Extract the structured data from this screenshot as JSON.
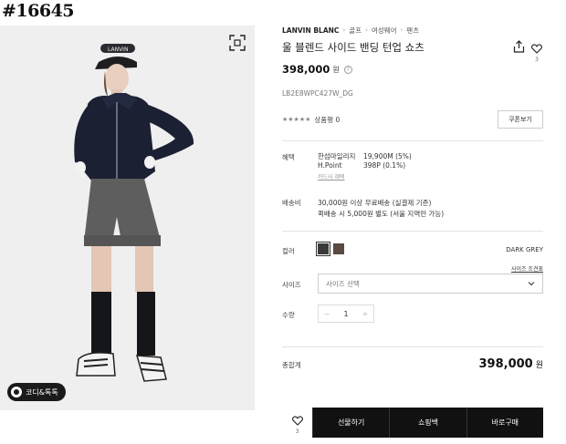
{
  "post_tag": "#16645",
  "photo": {
    "coordi_button": "코디&톡톡",
    "cap_text": "LANVIN"
  },
  "breadcrumb": [
    "LANVIN BLANC",
    "골프",
    "여성웨어",
    "팬츠"
  ],
  "product": {
    "title": "울 블렌드 사이드 밴딩 턴업 쇼츠",
    "price": "398,000",
    "price_unit": "원",
    "code": "LB2E8WPC427W_DG",
    "rating_stars": "★★★★★",
    "reviews": "상품평 0",
    "coupon_button": "쿠폰보기",
    "like_count": "3"
  },
  "benefit": {
    "label": "혜택",
    "rows": [
      {
        "name": "한섬마일리지",
        "value": "19,900M (5%)"
      },
      {
        "name": "H.Point",
        "value": "398P (0.1%)"
      }
    ],
    "card_link": "카드사 혜택"
  },
  "shipping": {
    "label": "배송비",
    "lines": [
      "30,000원 이상 무료배송 (실결제 기준)",
      "퀵배송 시 5,000원 별도 (서울 지역만 가능)"
    ]
  },
  "color": {
    "label": "컬러",
    "swatches": [
      "#3a3a3a",
      "#5a4a42"
    ],
    "selected_name": "DARK GREY",
    "size_guide": "사이즈 조견표"
  },
  "size": {
    "label": "사이즈",
    "placeholder": "사이즈 선택"
  },
  "quantity": {
    "label": "수량",
    "minus": "−",
    "value": "1",
    "plus": "+"
  },
  "total": {
    "label": "총합계",
    "value": "398,000",
    "unit": "원"
  },
  "buy_bar": {
    "wish_count": "3",
    "gift": "선물하기",
    "cart": "쇼핑백",
    "buy_now": "바로구매"
  }
}
